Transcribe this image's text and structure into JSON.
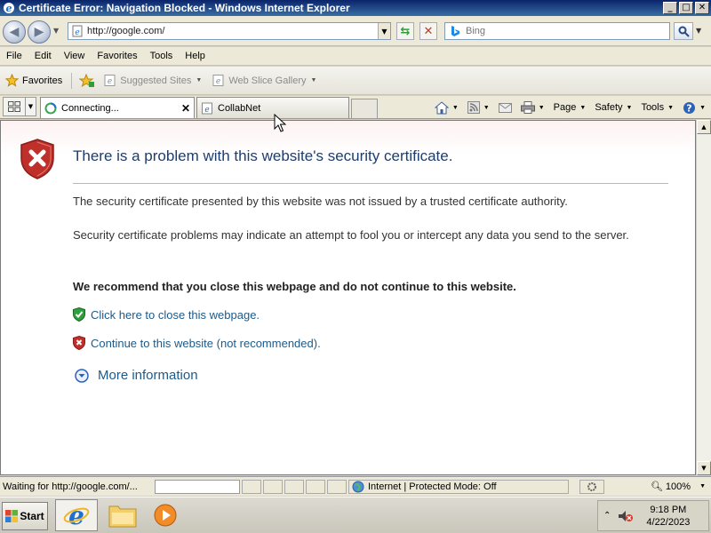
{
  "window": {
    "title": "Certificate Error: Navigation Blocked - Windows Internet Explorer",
    "controls": [
      "_",
      "□",
      "✕"
    ]
  },
  "address_bar": {
    "url": "http://google.com/",
    "search_placeholder": "Bing"
  },
  "menu": [
    "File",
    "Edit",
    "View",
    "Favorites",
    "Tools",
    "Help"
  ],
  "favorites_bar": {
    "favorites_label": "Favorites",
    "links": [
      "Suggested Sites",
      "Web Slice Gallery"
    ]
  },
  "tabs": [
    {
      "label": "Connecting...",
      "active": true
    },
    {
      "label": "CollabNet",
      "active": false
    }
  ],
  "command_bar": {
    "page": "Page",
    "safety": "Safety",
    "tools": "Tools"
  },
  "error_page": {
    "title": "There is a problem with this website's security certificate.",
    "paragraph1": "The security certificate presented by this website was not issued by a trusted certificate authority.",
    "paragraph2": "Security certificate problems may indicate an attempt to fool you or intercept any data you send to the server.",
    "recommendation": "We recommend that you close this webpage and do not continue to this website.",
    "close_link": "Click here to close this webpage.",
    "continue_link": "Continue to this website (not recommended).",
    "more_info": "More information"
  },
  "status_bar": {
    "status_text": "Waiting for http://google.com/...",
    "zone": "Internet | Protected Mode: Off",
    "zoom": "100%"
  },
  "taskbar": {
    "start_label": "Start",
    "time": "9:18 PM",
    "date": "4/22/2023"
  },
  "colors": {
    "link": "#1c5a8a",
    "title_text": "#1f3d6b",
    "titlebar": "#0a246a"
  }
}
